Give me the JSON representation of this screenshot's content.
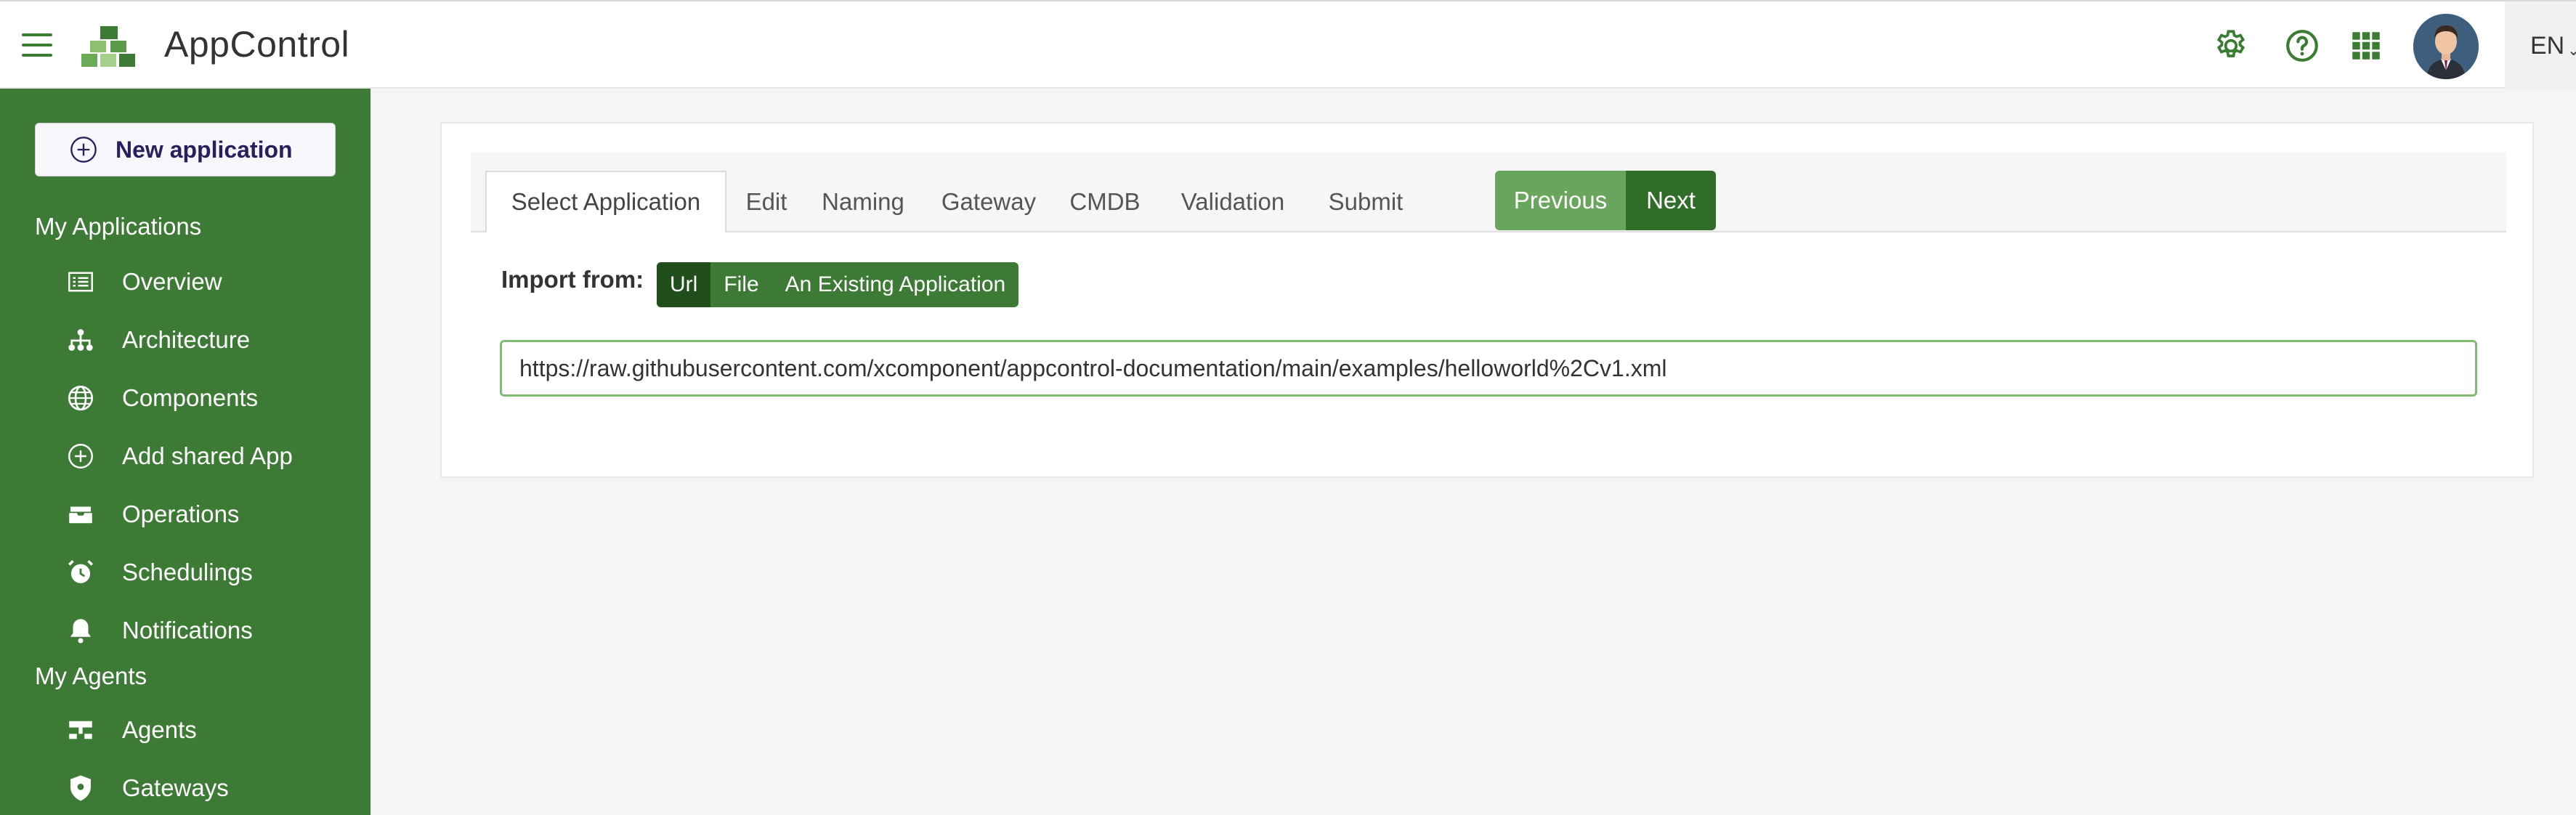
{
  "header": {
    "app_title": "AppControl",
    "icons": [
      "menu-icon",
      "logo-icon",
      "settings-icon",
      "help-icon",
      "apps-grid-icon",
      "avatar"
    ],
    "language": "EN",
    "accent_color": "#3d7a35"
  },
  "sidebar": {
    "new_app_label": "New application",
    "sections": [
      {
        "title": "My Applications",
        "items": [
          {
            "label": "Overview",
            "icon": "list-icon"
          },
          {
            "label": "Architecture",
            "icon": "hierarchy-icon"
          },
          {
            "label": "Components",
            "icon": "globe-icon"
          },
          {
            "label": "Add shared App",
            "icon": "plus-circle-icon"
          },
          {
            "label": "Operations",
            "icon": "inbox-icon"
          },
          {
            "label": "Schedulings",
            "icon": "alarm-clock-icon"
          },
          {
            "label": "Notifications",
            "icon": "bell-icon"
          }
        ]
      },
      {
        "title": "My Agents",
        "items": [
          {
            "label": "Agents",
            "icon": "server-icon"
          },
          {
            "label": "Gateways",
            "icon": "shield-icon"
          }
        ]
      }
    ]
  },
  "wizard": {
    "tabs": [
      "Select Application",
      "Edit",
      "Naming",
      "Gateway",
      "CMDB",
      "Validation",
      "Submit"
    ],
    "active_tab": "Select Application",
    "previous_label": "Previous",
    "next_label": "Next",
    "import_label": "Import from:",
    "import_options": [
      "Url",
      "File",
      "An Existing Application"
    ],
    "selected_import": "Url",
    "url_value": "https://raw.githubusercontent.com/xcomponent/appcontrol-documentation/main/examples/helloworld%2Cv1.xml"
  }
}
